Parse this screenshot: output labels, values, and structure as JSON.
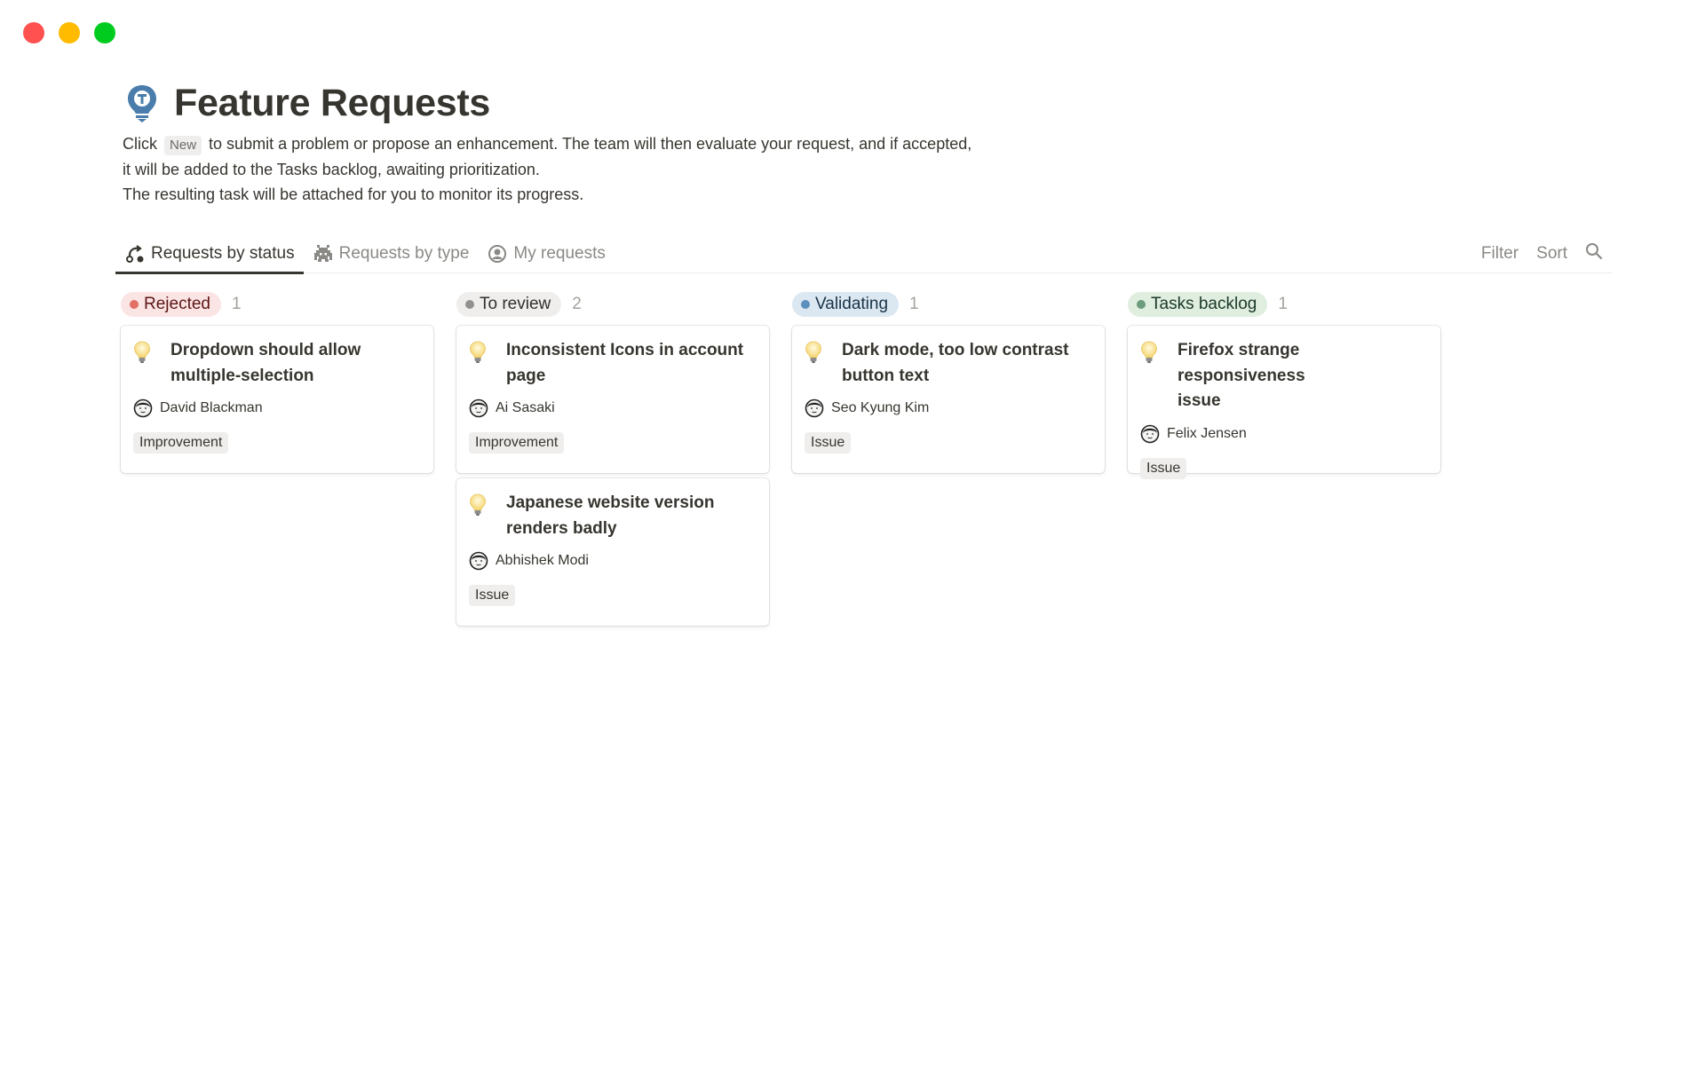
{
  "window": {
    "controls": [
      "close",
      "minimize",
      "maximize"
    ]
  },
  "page": {
    "icon": "lightbulb-icon",
    "title": "Feature Requests",
    "description": {
      "line1_before": "Click",
      "inline_button": "New",
      "line1_after": "to submit a problem or propose an enhancement. The team will then evaluate your request, and if accepted,",
      "line2": "it will be added to the Tasks backlog, awaiting prioritization.",
      "line3": "The resulting task will be attached for you to monitor its progress."
    }
  },
  "tabs": [
    {
      "label": "Requests by status",
      "icon": "status-flow-icon",
      "active": true
    },
    {
      "label": "Requests by type",
      "icon": "space-invader-icon",
      "active": false
    },
    {
      "label": "My requests",
      "icon": "user-circle-icon",
      "active": false
    }
  ],
  "toolbar": {
    "filter_label": "Filter",
    "sort_label": "Sort",
    "search_icon": "search-icon"
  },
  "columns": [
    {
      "name": "Rejected",
      "count": "1",
      "colors": {
        "bg": "#fbe4e4",
        "dot": "#e16f64",
        "text": "#5d1715"
      },
      "cards": [
        {
          "title_l1": "Dropdown should allow",
          "title_l2": "multiple-selection",
          "person": "David Blackman",
          "tag": "Improvement"
        }
      ]
    },
    {
      "name": "To review",
      "count": "2",
      "colors": {
        "bg": "#efeeec",
        "dot": "#91918e",
        "text": "#32302c"
      },
      "cards": [
        {
          "title_l1": "Inconsistent Icons in account",
          "title_l2": "page",
          "person": "Ai Sasaki",
          "tag": "Improvement"
        },
        {
          "title_l1": "Japanese website version",
          "title_l2": "renders badly",
          "person": "Abhishek Modi",
          "tag": "Issue"
        }
      ]
    },
    {
      "name": "Validating",
      "count": "1",
      "colors": {
        "bg": "#dbe7f1",
        "dot": "#5b8fbd",
        "text": "#183347"
      },
      "cards": [
        {
          "title_l1": "Dark mode, too low contrast",
          "title_l2": "button text",
          "person": "Seo Kyung Kim",
          "tag": "Issue"
        }
      ]
    },
    {
      "name": "Tasks backlog",
      "count": "1",
      "colors": {
        "bg": "#dfeedf",
        "dot": "#6c9b7d",
        "text": "#1c3829"
      },
      "cards": [
        {
          "title_l1": "Firefox strange responsiveness",
          "title_l2": "issue",
          "person": "Felix Jensen",
          "tag": "Issue"
        }
      ]
    }
  ]
}
